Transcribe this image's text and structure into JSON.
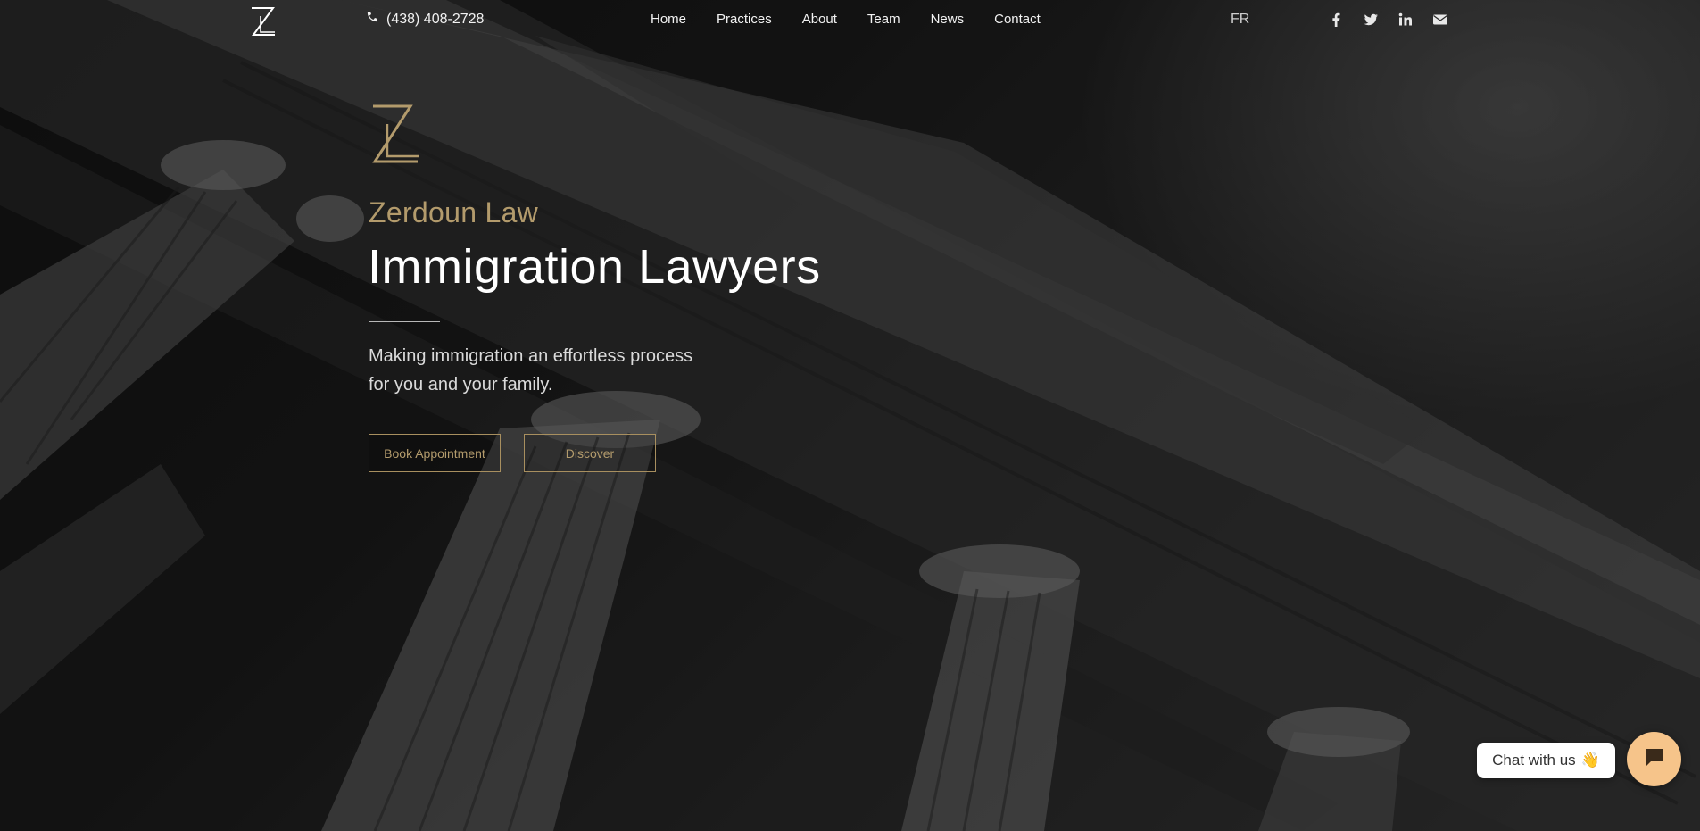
{
  "header": {
    "phone": "(438) 408-2728",
    "menu": [
      "Home",
      "Practices",
      "About",
      "Team",
      "News",
      "Contact"
    ],
    "language": "FR",
    "social_icons": [
      "facebook-icon",
      "twitter-icon",
      "linkedin-icon",
      "envelope-icon"
    ]
  },
  "hero": {
    "firm_name": "Zerdoun Law",
    "headline": "Immigration Lawyers",
    "tagline": "Making immigration an effortless process for you and your family.",
    "book_label": "Book Appointment",
    "discover_label": "Discover"
  },
  "chat": {
    "label": "Chat with us",
    "emoji": "👋"
  },
  "colors": {
    "accent_gold": "#b39b6c",
    "chat_orange": "#f6c48a"
  }
}
